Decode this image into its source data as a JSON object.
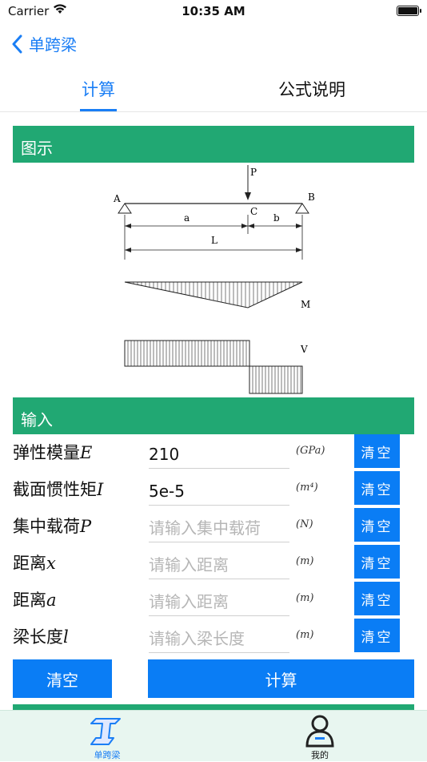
{
  "status": {
    "carrier": "Carrier",
    "time": "10:35 AM"
  },
  "nav": {
    "back_label": "单跨梁"
  },
  "tabs": [
    {
      "label": "计算"
    },
    {
      "label": "公式说明"
    }
  ],
  "sections": {
    "diagram_title": "图示",
    "input_title": "输入"
  },
  "diagram": {
    "label_p": "P",
    "label_a_point": "A",
    "label_b_point": "B",
    "label_c": "C",
    "dim_a": "a",
    "dim_b": "b",
    "dim_l": "L",
    "label_m": "M",
    "label_v": "V"
  },
  "inputs": [
    {
      "label": "弹性模量",
      "symbol": "E",
      "value": "210",
      "placeholder": "",
      "unit": "(GPa)",
      "clear": "清空"
    },
    {
      "label": "截面惯性矩",
      "symbol": "I",
      "value": "5e-5",
      "placeholder": "",
      "unit": "(m⁴)",
      "clear": "清空"
    },
    {
      "label": "集中载荷",
      "symbol": "P",
      "value": "",
      "placeholder": "请输入集中载荷",
      "unit": "(N)",
      "clear": "清空"
    },
    {
      "label": "距离",
      "symbol": "x",
      "value": "",
      "placeholder": "请输入距离",
      "unit": "(m)",
      "clear": "清空"
    },
    {
      "label": "距离",
      "symbol": "a",
      "value": "",
      "placeholder": "请输入距离",
      "unit": "(m)",
      "clear": "清空"
    },
    {
      "label": "梁长度",
      "symbol": "l",
      "value": "",
      "placeholder": "请输入梁长度",
      "unit": "(m)",
      "clear": "清空"
    }
  ],
  "actions": {
    "clear_all": "清空",
    "calculate": "计算"
  },
  "tabbar": [
    {
      "label": "单跨梁",
      "icon": "beam-icon"
    },
    {
      "label": "我的",
      "icon": "user-icon"
    }
  ],
  "colors": {
    "accent": "#1a7ef5",
    "section": "#21a873",
    "button": "#0a7df5"
  }
}
